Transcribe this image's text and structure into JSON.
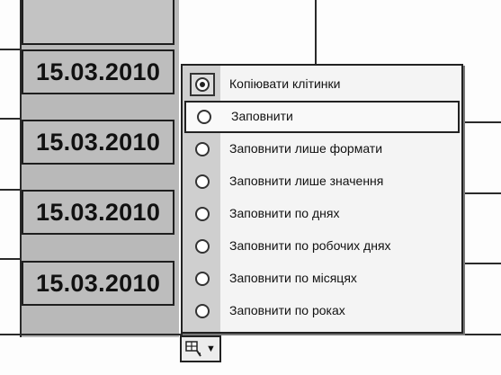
{
  "cells": [
    {
      "value": "15.03.2010"
    },
    {
      "value": "15.03.2010"
    },
    {
      "value": "15.03.2010"
    },
    {
      "value": "15.03.2010"
    }
  ],
  "autofill_menu": {
    "items": [
      {
        "label": "Копіювати клітинки",
        "selected": true
      },
      {
        "label": "Заповнити",
        "selected": false
      },
      {
        "label": "Заповнити лише формати",
        "selected": false
      },
      {
        "label": "Заповнити лише значення",
        "selected": false
      },
      {
        "label": "Заповнити по днях",
        "selected": false
      },
      {
        "label": "Заповнити по робочих днях",
        "selected": false
      },
      {
        "label": "Заповнити по місяцях",
        "selected": false
      },
      {
        "label": "Заповнити по роках",
        "selected": false
      }
    ]
  },
  "smart_tag": {
    "icon": "autofill-options-icon",
    "dropdown_icon": "chevron-down-icon"
  }
}
